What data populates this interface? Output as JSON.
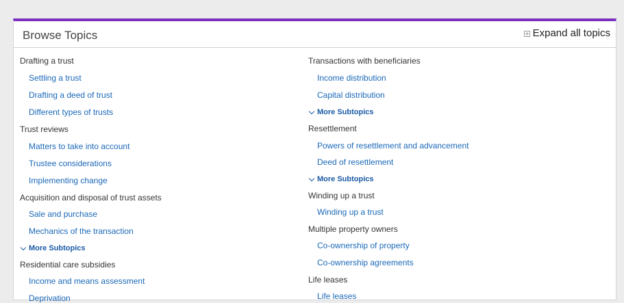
{
  "header": {
    "title": "Browse Topics",
    "expand_all_label": "Expand all topics"
  },
  "more_label": "More Subtopics",
  "left_column": [
    {
      "type": "topic",
      "label": "Drafting a trust"
    },
    {
      "type": "sub",
      "label": "Settling a trust"
    },
    {
      "type": "sub",
      "label": "Drafting a deed of trust"
    },
    {
      "type": "sub",
      "label": "Different types of trusts"
    },
    {
      "type": "topic",
      "label": "Trust reviews"
    },
    {
      "type": "sub",
      "label": "Matters to take into account"
    },
    {
      "type": "sub",
      "label": "Trustee considerations"
    },
    {
      "type": "sub",
      "label": "Implementing change"
    },
    {
      "type": "topic",
      "label": "Acquisition and disposal of trust assets"
    },
    {
      "type": "sub",
      "label": "Sale and purchase"
    },
    {
      "type": "sub",
      "label": "Mechanics of the transaction"
    },
    {
      "type": "more",
      "label": "More Subtopics"
    },
    {
      "type": "topic",
      "label": "Residential care subsidies"
    },
    {
      "type": "sub",
      "label": "Income and means assessment"
    },
    {
      "type": "sub",
      "label": "Deprivation"
    }
  ],
  "right_column": [
    {
      "type": "topic",
      "label": "Transactions with beneficiaries"
    },
    {
      "type": "sub",
      "label": "Income distribution"
    },
    {
      "type": "sub",
      "label": "Capital distribution"
    },
    {
      "type": "more",
      "label": "More Subtopics"
    },
    {
      "type": "topic",
      "label": "Resettlement"
    },
    {
      "type": "sub",
      "label": "Powers of resettlement and advancement"
    },
    {
      "type": "sub",
      "label": "Deed of resettlement"
    },
    {
      "type": "more",
      "label": "More Subtopics"
    },
    {
      "type": "topic",
      "label": "Winding up a trust"
    },
    {
      "type": "sub",
      "label": "Winding up a trust"
    },
    {
      "type": "topic",
      "label": "Multiple property owners"
    },
    {
      "type": "sub",
      "label": "Co-ownership of property"
    },
    {
      "type": "sub",
      "label": "Co-ownership agreements"
    },
    {
      "type": "topic",
      "label": "Life leases"
    },
    {
      "type": "sub",
      "label": "Life leases"
    }
  ]
}
